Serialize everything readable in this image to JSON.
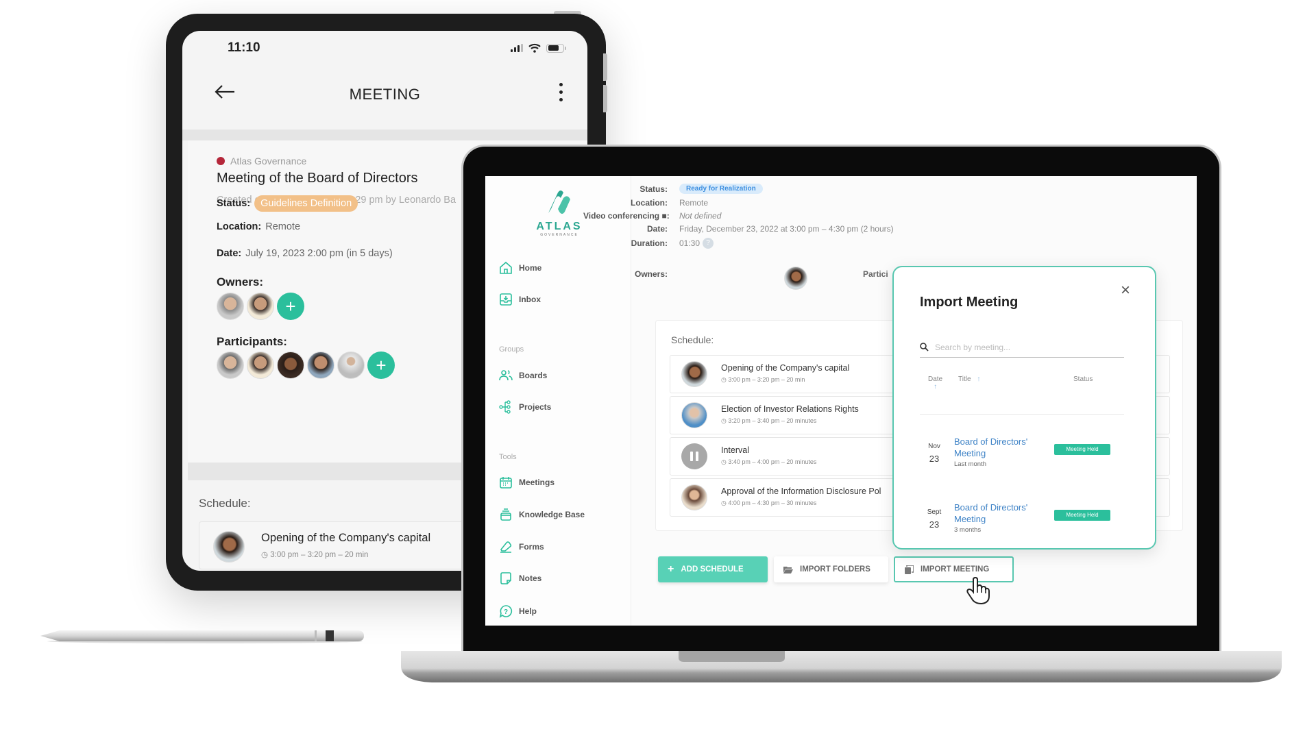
{
  "tablet": {
    "status_bar": {
      "time": "11:10",
      "icons": [
        "signal-icon",
        "wifi-icon",
        "battery-icon"
      ]
    },
    "header": {
      "back_icon": "arrow-left-icon",
      "title": "MEETING",
      "menu_icon": "more-vertical-icon"
    },
    "meeting": {
      "organization": "Atlas Governance",
      "organization_color": "#b5273a",
      "title": "Meeting of the Board of Directors",
      "created": "Created on February 8, 2019 1:29 pm by Leonardo Ba",
      "status_label": "Status:",
      "status_value": "Guidelines Definition",
      "status_color": "#f2c088",
      "location_label": "Location:",
      "location_value": "Remote",
      "date_label": "Date:",
      "date_value": "July 19, 2023 2:00 pm (in 5 days)",
      "owners_label": "Owners:",
      "owners_count": 2,
      "participants_label": "Participants:",
      "participants_count": 5,
      "add_label": "+"
    },
    "schedule": {
      "label": "Schedule:",
      "items": [
        {
          "title": "Opening of the Company's capital",
          "time": "3:00 pm  – 3:20 pm – 20 min"
        }
      ]
    }
  },
  "laptop": {
    "sidebar": {
      "brand": "ATLAS",
      "brand_sub": "GOVERNANCE",
      "brand_color": "#2ba791",
      "items_top": [
        {
          "label": "Home",
          "icon": "home-icon"
        },
        {
          "label": "Inbox",
          "icon": "inbox-icon"
        }
      ],
      "group_label": "Groups",
      "items_groups": [
        {
          "label": "Boards",
          "icon": "users-icon"
        },
        {
          "label": "Projects",
          "icon": "hierarchy-icon"
        }
      ],
      "tools_label": "Tools",
      "items_tools": [
        {
          "label": "Meetings",
          "icon": "calendar-icon"
        },
        {
          "label": "Knowledge Base",
          "icon": "archive-icon"
        },
        {
          "label": "Forms",
          "icon": "eraser-icon"
        },
        {
          "label": "Notes",
          "icon": "note-icon"
        },
        {
          "label": "Help",
          "icon": "help-bubble-icon"
        }
      ]
    },
    "details": {
      "status_label": "Status:",
      "status_value": "Ready for Realization",
      "status_color": "#3d8fe0",
      "location_label": "Location:",
      "location_value": "Remote",
      "video_label": "Video conferencing ■:",
      "video_value": "Not defined",
      "date_label": "Date:",
      "date_value": "Friday, December 23, 2022 at 3:00 pm – 4:30 pm (2 hours)",
      "duration_label": "Duration:",
      "duration_value": "01:30",
      "duration_help": "?",
      "owners_label": "Owners:",
      "participants_label": "Partici"
    },
    "schedule": {
      "label": "Schedule:",
      "items": [
        {
          "title": "Opening of the Company's capital",
          "time": "3:00 pm  – 3:20 pm – 20 min",
          "avatar": "photo"
        },
        {
          "title": "Election of Investor Relations Rights",
          "time": "3:20 pm  – 3:40 pm – 20 minutes",
          "avatar": "photo"
        },
        {
          "title": "Interval",
          "time": "3:40 pm  – 4:00 pm – 20 minutes",
          "avatar": "pause-icon"
        },
        {
          "title": "Approval of the Information Disclosure Pol",
          "time": "4:00 pm  – 4:30 pm – 30 minutes",
          "avatar": "photo"
        }
      ]
    },
    "buttons": {
      "add_schedule": "ADD SCHEDULE",
      "import_folders": "IMPORT FOLDERS",
      "import_meeting": "IMPORT MEETING",
      "accent": "#58d1b6"
    },
    "modal": {
      "title": "Import Meeting",
      "close": "×",
      "search_placeholder": "Search by meeting...",
      "columns": {
        "date": "Date",
        "title": "Title",
        "status": "Status"
      },
      "sort_arrow": "↑",
      "rows": [
        {
          "month": "Nov",
          "day": "23",
          "title": "Board of Directors' Meeting",
          "ago": "Last month",
          "status": "Meeting Held"
        },
        {
          "month": "Sept",
          "day": "23",
          "title": "Board of Directors' Meeting",
          "ago": "3 months",
          "status": "Meeting Held"
        }
      ]
    }
  }
}
